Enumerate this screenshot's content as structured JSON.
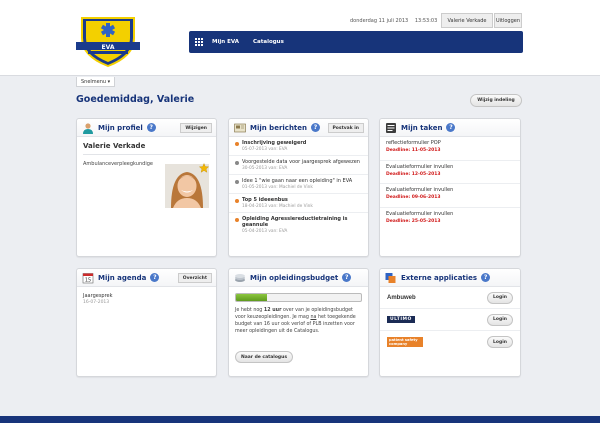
{
  "logo": {
    "text": "EVA"
  },
  "header": {
    "date": "donderdag 11 juli 2013",
    "time": "13:53:03",
    "user_button": "Valerie Verkade",
    "logout_button": "Uitloggen"
  },
  "nav": {
    "items": [
      "Mijn EVA",
      "Catalogus"
    ]
  },
  "snelmenu": "Snelmenu ▾",
  "greeting": "Goedemiddag, Valerie",
  "wijzig_button": "Wijzig indeling",
  "profiel": {
    "title": "Mijn profiel",
    "button": "Wijzigen",
    "name": "Valerie Verkade",
    "role": "Ambulanceverpleegkundige"
  },
  "berichten": {
    "title": "Mijn berichten",
    "button": "Postvak in",
    "items": [
      {
        "title": "Inschrijving geweigerd",
        "meta": "05-07-2013 van: EVA",
        "bold": true,
        "color": "#e8822a"
      },
      {
        "title": "Voorgestelde data voor jaargesprek afgewezen",
        "meta": "30-05-2013 van: EVA",
        "bold": false,
        "color": "#888888"
      },
      {
        "title": "Idee 1 \"wie gaan naar een opleiding\" in EVA",
        "meta": "01-05-2013 van: Machiel de Vink",
        "bold": false,
        "color": "#888888"
      },
      {
        "title": "Top 5 ideeenbus",
        "meta": "18-04-2013 van: Machiel de Vink",
        "bold": true,
        "color": "#e8822a"
      },
      {
        "title": "Opleiding Agressiereductietraining is geannule",
        "meta": "05-04-2013 van: EVA",
        "bold": true,
        "color": "#e8822a"
      }
    ]
  },
  "taken": {
    "title": "Mijn taken",
    "items": [
      {
        "title": "reflectieformulier POP",
        "deadline": "Deadline: 11-05-2013"
      },
      {
        "title": "Evaluatieformulier invullen",
        "deadline": "Deadline: 12-05-2013"
      },
      {
        "title": "Evaluatieformulier invullen",
        "deadline": "Deadline: 09-06-2013"
      },
      {
        "title": "Evaluatieformulier invullen",
        "deadline": "Deadline: 25-05-2013"
      }
    ]
  },
  "agenda": {
    "title": "Mijn agenda",
    "button": "Overzicht",
    "icon_day": "15",
    "item_title": "Jaargesprek",
    "item_date": "16-07-2013"
  },
  "budget": {
    "title": "Mijn opleidingsbudget",
    "progress_percent": 25,
    "text_1": "Je hebt nog ",
    "bold_1": "12 uur",
    "text_2": " over van je opleidingsbudget voor keuzeopleidingen. Je mag ",
    "underline": "na",
    "text_3": " het toegekende budget van 16 uur ook verlof of PLB inzetten voor meer opleidingen uit de Catalogus.",
    "button": "Naar de catalogus"
  },
  "externe": {
    "title": "Externe applicaties",
    "apps": [
      {
        "name": "Ambuweb",
        "login": "Login"
      },
      {
        "name": "ULTIMO",
        "login": "Login"
      },
      {
        "name": "patient safety company",
        "login": "Login"
      }
    ]
  },
  "colors": {
    "brand": "#17347a",
    "accent": "#e8822a",
    "deadline": "#d01919"
  }
}
